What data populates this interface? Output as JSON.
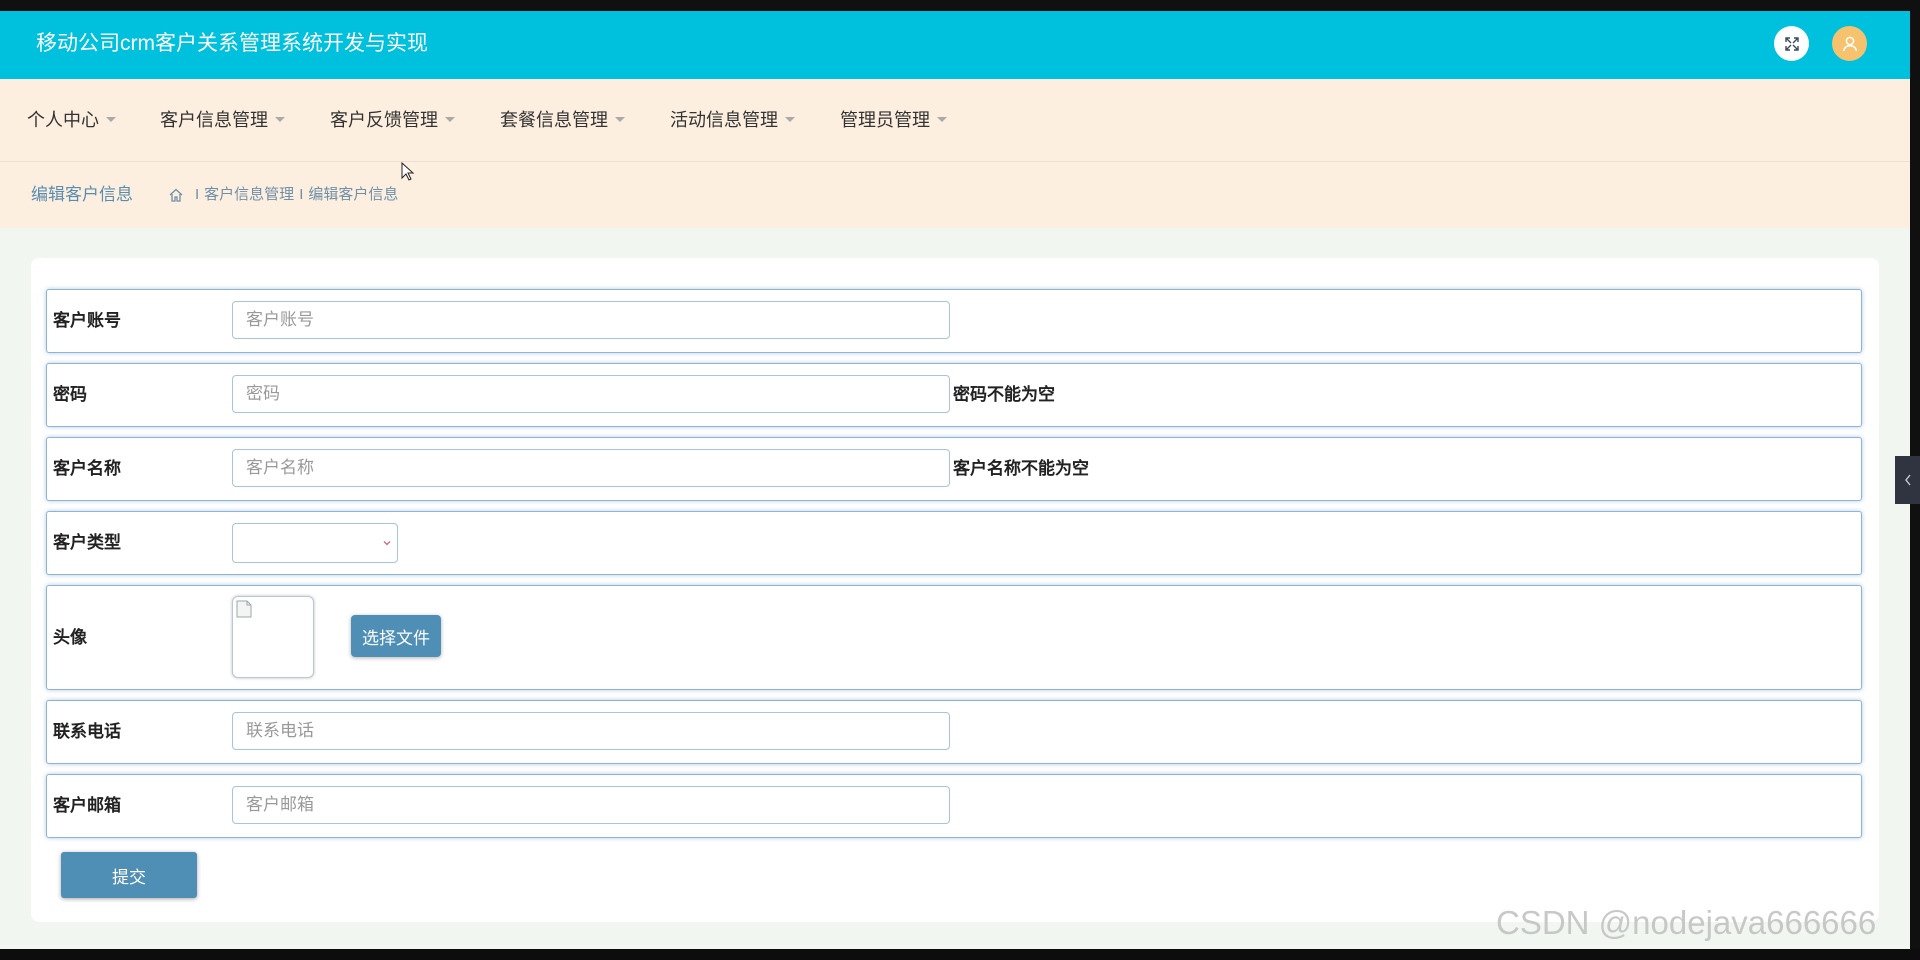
{
  "header": {
    "title": "移动公司crm客户关系管理系统开发与实现",
    "icons": {
      "fullscreen": "fullscreen-icon",
      "user": "user-icon"
    },
    "colors": {
      "bar": "#00c1dd",
      "user_button": "#f7c26d"
    }
  },
  "nav": {
    "items": [
      {
        "label": "个人中心"
      },
      {
        "label": "客户信息管理"
      },
      {
        "label": "客户反馈管理"
      },
      {
        "label": "套餐信息管理"
      },
      {
        "label": "活动信息管理"
      },
      {
        "label": "管理员管理"
      }
    ]
  },
  "breadcrumb": {
    "page_title": "编辑客户信息",
    "items": [
      "客户信息管理",
      "编辑客户信息"
    ],
    "separator": "I"
  },
  "form": {
    "fields": [
      {
        "label": "客户账号",
        "placeholder": "客户账号",
        "error": ""
      },
      {
        "label": "密码",
        "placeholder": "密码",
        "error": "密码不能为空"
      },
      {
        "label": "客户名称",
        "placeholder": "客户名称",
        "error": "客户名称不能为空"
      },
      {
        "label": "客户类型",
        "selected": ""
      },
      {
        "label": "头像",
        "file_button": "选择文件"
      },
      {
        "label": "联系电话",
        "placeholder": "联系电话",
        "error": ""
      },
      {
        "label": "客户邮箱",
        "placeholder": "客户邮箱",
        "error": ""
      }
    ],
    "submit_label": "提交"
  },
  "watermark": "CSDN @nodejava666666"
}
